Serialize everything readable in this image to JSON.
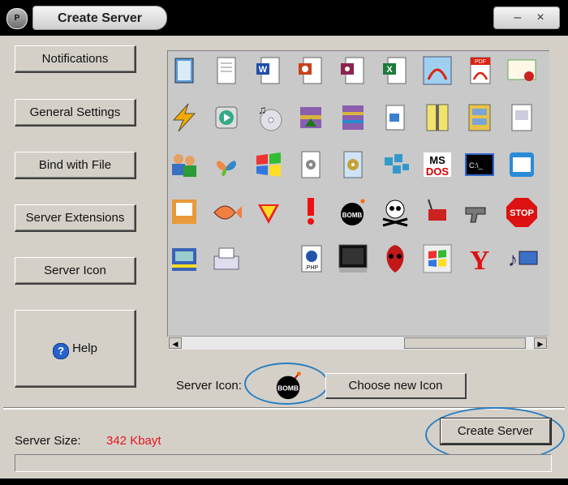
{
  "window": {
    "title": "Create Server",
    "minimize_symbol": "–",
    "close_symbol": "×"
  },
  "nav": {
    "items": [
      {
        "label": "Notifications"
      },
      {
        "label": "General Settings"
      },
      {
        "label": "Bind with File"
      },
      {
        "label": "Server Extensions"
      },
      {
        "label": "Server Icon"
      },
      {
        "label": "Help"
      }
    ]
  },
  "icons": [
    "notepad-icon",
    "text-document-icon",
    "word-document-icon",
    "powerpoint-icon",
    "access-icon",
    "excel-icon",
    "acrobat-icon",
    "pdf-icon",
    "certificate-icon",
    "winamp-icon",
    "media-player-icon",
    "cd-audio-icon",
    "winrar-installer-icon",
    "winrar-archive-icon",
    "file-link-icon",
    "zip-icon",
    "archive-cabinet-icon",
    "frame-icon",
    "msn-users-icon",
    "msn-butterfly-icon",
    "windows-xp-icon",
    "settings-file-icon",
    "gear-document-icon",
    "registry-icon",
    "ms-dos-icon",
    "command-prompt-icon",
    "shortcut-icon",
    "finder-icon",
    "fish-icon",
    "superman-icon",
    "exclamation-icon",
    "bomb-icon",
    "skull-icon",
    "dynamite-icon",
    "revolver-icon",
    "stop-sign-icon",
    "network-icon",
    "fax-icon",
    "php-file-icon",
    "tv-screen-icon",
    "alien-icon",
    "windows-flag-icon",
    "yahoo-icon",
    "music-video-icon"
  ],
  "server_icon": {
    "label": "Server Icon:",
    "selected": "bomb-icon",
    "bomb_text": "BOMB",
    "choose_button": "Choose new Icon"
  },
  "footer": {
    "size_label": "Server Size:",
    "size_value": "342 Kbayt",
    "create_button": "Create Server",
    "progress": 0
  },
  "colors": {
    "size_value": "#e8141c",
    "highlight_ellipse": "#2b7fc1"
  }
}
